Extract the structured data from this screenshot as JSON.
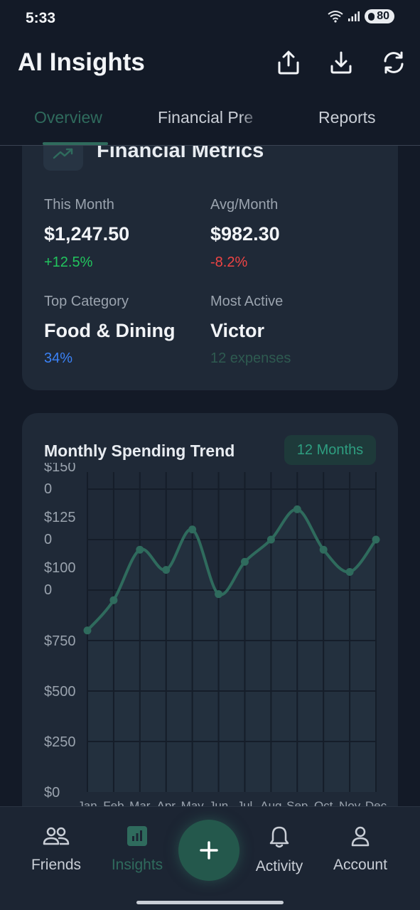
{
  "status": {
    "time": "5:33",
    "battery": "80"
  },
  "header": {
    "title": "AI Insights"
  },
  "tabs": [
    {
      "label": "Overview",
      "active": true
    },
    {
      "label": "Financial Pre"
    },
    {
      "label": "Reports"
    }
  ],
  "metrics": {
    "title": "Financial Metrics",
    "this_month": {
      "label": "This Month",
      "value": "$1,247.50",
      "change": "+12.5%"
    },
    "avg_month": {
      "label": "Avg/Month",
      "value": "$982.30",
      "change": "-8.2%"
    },
    "top_category": {
      "label": "Top Category",
      "value": "Food & Dining",
      "sub": "34%"
    },
    "most_active": {
      "label": "Most Active",
      "value": "Victor",
      "sub": "12 expenses"
    }
  },
  "colors": {
    "accent": "#2f6b5d",
    "positive": "#22c55e",
    "negative": "#ef4444",
    "info": "#3b82f6",
    "card": "#1f2937",
    "background": "#131a27"
  },
  "chart_data": {
    "type": "line",
    "title": "Monthly Spending Trend",
    "badge": "12 Months",
    "categories": [
      "Jan",
      "Feb",
      "Mar",
      "Apr",
      "May",
      "Jun",
      "Jul",
      "Aug",
      "Sep",
      "Oct",
      "Nov",
      "Dec"
    ],
    "series": [
      {
        "values": [
          800,
          950,
          1200,
          1100,
          1300,
          980,
          1140,
          1250,
          1400,
          1200,
          1090,
          1250
        ]
      }
    ],
    "y_ticks": [
      {
        "value": 0,
        "line1": "$0",
        "line2": ""
      },
      {
        "value": 250,
        "line1": "$250",
        "line2": ""
      },
      {
        "value": 500,
        "line1": "$500",
        "line2": ""
      },
      {
        "value": 750,
        "line1": "$750",
        "line2": ""
      },
      {
        "value": 1000,
        "line1": "$100",
        "line2": "0"
      },
      {
        "value": 1250,
        "line1": "$125",
        "line2": "0"
      },
      {
        "value": 1500,
        "line1": "$150",
        "line2": "0"
      }
    ],
    "ylim": [
      0,
      1500
    ],
    "grid": true,
    "line_color": "#2f6b5d"
  },
  "nav": {
    "items": [
      {
        "label": "Friends",
        "icon": "friends-icon"
      },
      {
        "label": "Insights",
        "icon": "insights-icon",
        "active": true
      },
      {
        "label": "Activity",
        "icon": "bell-icon"
      },
      {
        "label": "Account",
        "icon": "account-icon"
      }
    ],
    "fab_icon": "plus-icon"
  }
}
